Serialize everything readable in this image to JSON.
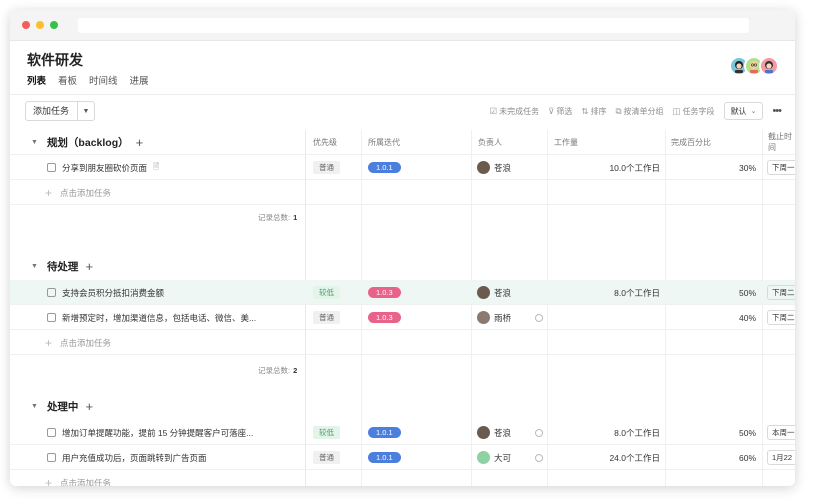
{
  "window": {
    "dots": [
      "#f25f58",
      "#fbbe2e",
      "#38c149"
    ]
  },
  "project": {
    "title": "软件研发"
  },
  "views": [
    {
      "label": "列表",
      "active": true
    },
    {
      "label": "看板",
      "active": false
    },
    {
      "label": "时间线",
      "active": false
    },
    {
      "label": "进展",
      "active": false
    }
  ],
  "members": [
    "member-avatar-1",
    "member-avatar-2",
    "member-avatar-3"
  ],
  "toolbar": {
    "add_task": "添加任务",
    "hide_done": "未完成任务",
    "filter": "筛选",
    "sort": "排序",
    "group": "按清单分组",
    "fields": "任务字段",
    "default_view": "默认"
  },
  "columns": {
    "priority": "优先级",
    "iteration": "所属迭代",
    "assignee": "负责人",
    "workload": "工作量",
    "progress": "完成百分比",
    "due": "截止时间"
  },
  "groups": [
    {
      "title": "规划（backlog）",
      "tasks": [
        {
          "name": "分享到朋友圈砍价页面",
          "priority": "普通",
          "priority_kind": "normal",
          "iteration": "1.0.1",
          "iteration_color": "#4a7fde",
          "assignee": "苍浪",
          "workload": "10.0个工作日",
          "progress": "30%",
          "due": "下周一"
        }
      ],
      "add_label": "点击添加任务",
      "count_label": "记录总数:",
      "count": "1"
    },
    {
      "title": "待处理",
      "tasks": [
        {
          "name": "支持会员积分抵扣消费金额",
          "priority": "较低",
          "priority_kind": "low",
          "iteration": "1.0.3",
          "iteration_color": "#e8628a",
          "assignee": "苍浪",
          "workload": "8.0个工作日",
          "progress": "50%",
          "due": "下周二"
        },
        {
          "name": "新增预定时，增加渠道信息，包括电话、微信、美...",
          "priority": "普通",
          "priority_kind": "normal",
          "iteration": "1.0.3",
          "iteration_color": "#e8628a",
          "assignee": "雨桥",
          "workload": "",
          "progress": "40%",
          "due": "下周二"
        }
      ],
      "add_label": "点击添加任务",
      "count_label": "记录总数:",
      "count": "2"
    },
    {
      "title": "处理中",
      "tasks": [
        {
          "name": "增加订单提醒功能，提前 15 分钟提醒客户可落座...",
          "priority": "较低",
          "priority_kind": "low",
          "iteration": "1.0.1",
          "iteration_color": "#4a7fde",
          "assignee": "苍浪",
          "workload": "8.0个工作日",
          "progress": "50%",
          "due": "本周一"
        },
        {
          "name": "用户充值成功后，页面跳转到广告页面",
          "priority": "普通",
          "priority_kind": "normal",
          "iteration": "1.0.1",
          "iteration_color": "#4a7fde",
          "assignee": "大可",
          "workload": "24.0个工作日",
          "progress": "60%",
          "due": "1月22"
        }
      ],
      "add_label": "点击添加任务"
    }
  ]
}
